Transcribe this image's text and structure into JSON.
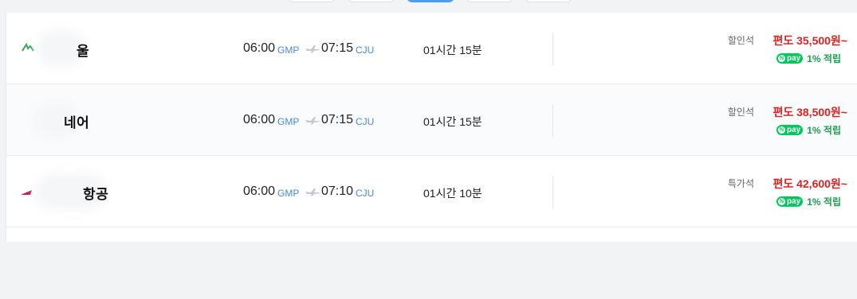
{
  "colors": {
    "price": "#e02020",
    "airport_code": "#4b8ad8",
    "npay_green": "#03c75a",
    "active_tab": "#4b9cf5"
  },
  "npay": {
    "badge_text": "pay",
    "badge_n": "N",
    "icon": "npay-icon"
  },
  "flights": [
    {
      "airline": "울",
      "logo_icon": "airline-logo-green-icon",
      "depart_time": "06:00",
      "depart_code": "GMP",
      "arrive_time": "07:15",
      "arrive_code": "CJU",
      "duration": "01시간 15분",
      "seat_class": "할인석",
      "price_prefix": "편도",
      "price": "35,500원~",
      "reward": "1% 적립"
    },
    {
      "airline": "네어",
      "logo_icon": "airline-logo-icon",
      "depart_time": "06:00",
      "depart_code": "GMP",
      "arrive_time": "07:15",
      "arrive_code": "CJU",
      "duration": "01시간 15분",
      "seat_class": "할인석",
      "price_prefix": "편도",
      "price": "38,500원~",
      "reward": "1% 적립"
    },
    {
      "airline": "항공",
      "logo_icon": "airline-logo-red-icon",
      "depart_time": "06:00",
      "depart_code": "GMP",
      "arrive_time": "07:10",
      "arrive_code": "CJU",
      "duration": "01시간 10분",
      "seat_class": "특가석",
      "price_prefix": "편도",
      "price": "42,600원~",
      "reward": "1% 적립"
    }
  ]
}
